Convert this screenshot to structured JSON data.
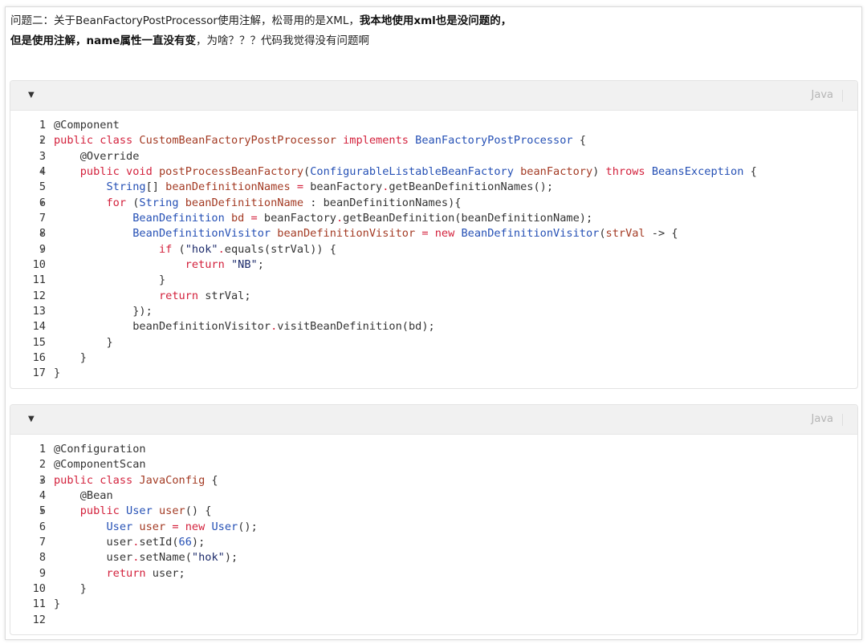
{
  "question": {
    "line1_normal": "问题二：关于BeanFactoryPostProcessor使用注解，松哥用的是XML，",
    "line1_bold": "我本地使用xml也是没问题的，",
    "line2_bold": "但是使用注解，name属性一直没有变",
    "line2_normal": "，为啥？？？代码我觉得没有问题啊"
  },
  "blocks": [
    {
      "language": "Java",
      "folds": [
        2,
        4,
        6,
        8,
        9
      ],
      "lines": [
        [
          [
            "p",
            "@Component"
          ]
        ],
        [
          [
            "k",
            "public class "
          ],
          [
            "v",
            "CustomBeanFactoryPostProcessor "
          ],
          [
            "k",
            "implements "
          ],
          [
            "t",
            "BeanFactoryPostProcessor"
          ],
          [
            "p",
            " {"
          ]
        ],
        [
          [
            "p",
            "    @Override"
          ]
        ],
        [
          [
            "k",
            "    public void "
          ],
          [
            "v",
            "postProcessBeanFactory"
          ],
          [
            "p",
            "("
          ],
          [
            "t",
            "ConfigurableListableBeanFactory "
          ],
          [
            "v",
            "beanFactory"
          ],
          [
            "p",
            ") "
          ],
          [
            "k",
            "throws "
          ],
          [
            "t",
            "BeansException"
          ],
          [
            "p",
            " {"
          ]
        ],
        [
          [
            "t",
            "        String"
          ],
          [
            "p",
            "[] "
          ],
          [
            "v",
            "beanDefinitionNames "
          ],
          [
            "o",
            "="
          ],
          [
            "p",
            " beanFactory"
          ],
          [
            "o",
            "."
          ],
          [
            "p",
            "getBeanDefinitionNames();"
          ]
        ],
        [
          [
            "k",
            "        for "
          ],
          [
            "p",
            "("
          ],
          [
            "t",
            "String "
          ],
          [
            "v",
            "beanDefinitionName "
          ],
          [
            "p",
            ": beanDefinitionNames){"
          ]
        ],
        [
          [
            "t",
            "            BeanDefinition "
          ],
          [
            "v",
            "bd "
          ],
          [
            "o",
            "="
          ],
          [
            "p",
            " beanFactory"
          ],
          [
            "o",
            "."
          ],
          [
            "p",
            "getBeanDefinition(beanDefinitionName);"
          ]
        ],
        [
          [
            "t",
            "            BeanDefinitionVisitor "
          ],
          [
            "v",
            "beanDefinitionVisitor "
          ],
          [
            "o",
            "= "
          ],
          [
            "k",
            "new "
          ],
          [
            "t",
            "BeanDefinitionVisitor"
          ],
          [
            "p",
            "("
          ],
          [
            "v",
            "strVal"
          ],
          [
            "p",
            " -> {"
          ]
        ],
        [
          [
            "k",
            "                if "
          ],
          [
            "p",
            "("
          ],
          [
            "s",
            "\"hok\""
          ],
          [
            "o",
            "."
          ],
          [
            "p",
            "equals(strVal)) {"
          ]
        ],
        [
          [
            "k",
            "                    return "
          ],
          [
            "s",
            "\"NB\""
          ],
          [
            "p",
            ";"
          ]
        ],
        [
          [
            "p",
            "                }"
          ]
        ],
        [
          [
            "k",
            "                return "
          ],
          [
            "p",
            "strVal;"
          ]
        ],
        [
          [
            "p",
            "            });"
          ]
        ],
        [
          [
            "p",
            "            beanDefinitionVisitor"
          ],
          [
            "o",
            "."
          ],
          [
            "p",
            "visitBeanDefinition(bd);"
          ]
        ],
        [
          [
            "p",
            "        }"
          ]
        ],
        [
          [
            "p",
            "    }"
          ]
        ],
        [
          [
            "p",
            "}"
          ]
        ]
      ]
    },
    {
      "language": "Java",
      "folds": [
        3,
        5
      ],
      "lines": [
        [
          [
            "p",
            "@Configuration"
          ]
        ],
        [
          [
            "p",
            "@ComponentScan"
          ]
        ],
        [
          [
            "k",
            "public class "
          ],
          [
            "v",
            "JavaConfig"
          ],
          [
            "p",
            " {"
          ]
        ],
        [
          [
            "p",
            "    @Bean"
          ]
        ],
        [
          [
            "k",
            "    public "
          ],
          [
            "t",
            "User "
          ],
          [
            "v",
            "user"
          ],
          [
            "p",
            "() {"
          ]
        ],
        [
          [
            "t",
            "        User "
          ],
          [
            "v",
            "user "
          ],
          [
            "o",
            "= "
          ],
          [
            "k",
            "new "
          ],
          [
            "t",
            "User"
          ],
          [
            "p",
            "();"
          ]
        ],
        [
          [
            "p",
            "        user"
          ],
          [
            "o",
            "."
          ],
          [
            "p",
            "setId("
          ],
          [
            "n",
            "66"
          ],
          [
            "p",
            ");"
          ]
        ],
        [
          [
            "p",
            "        user"
          ],
          [
            "o",
            "."
          ],
          [
            "p",
            "setName("
          ],
          [
            "s",
            "\"hok\""
          ],
          [
            "p",
            ");"
          ]
        ],
        [
          [
            "k",
            "        return "
          ],
          [
            "p",
            "user;"
          ]
        ],
        [
          [
            "p",
            "    }"
          ]
        ],
        [
          [
            "p",
            "}"
          ]
        ],
        [
          [
            "p",
            ""
          ]
        ]
      ]
    }
  ],
  "icons": {
    "fold": "chevron-down-icon",
    "collapse": "caret-down-icon"
  }
}
